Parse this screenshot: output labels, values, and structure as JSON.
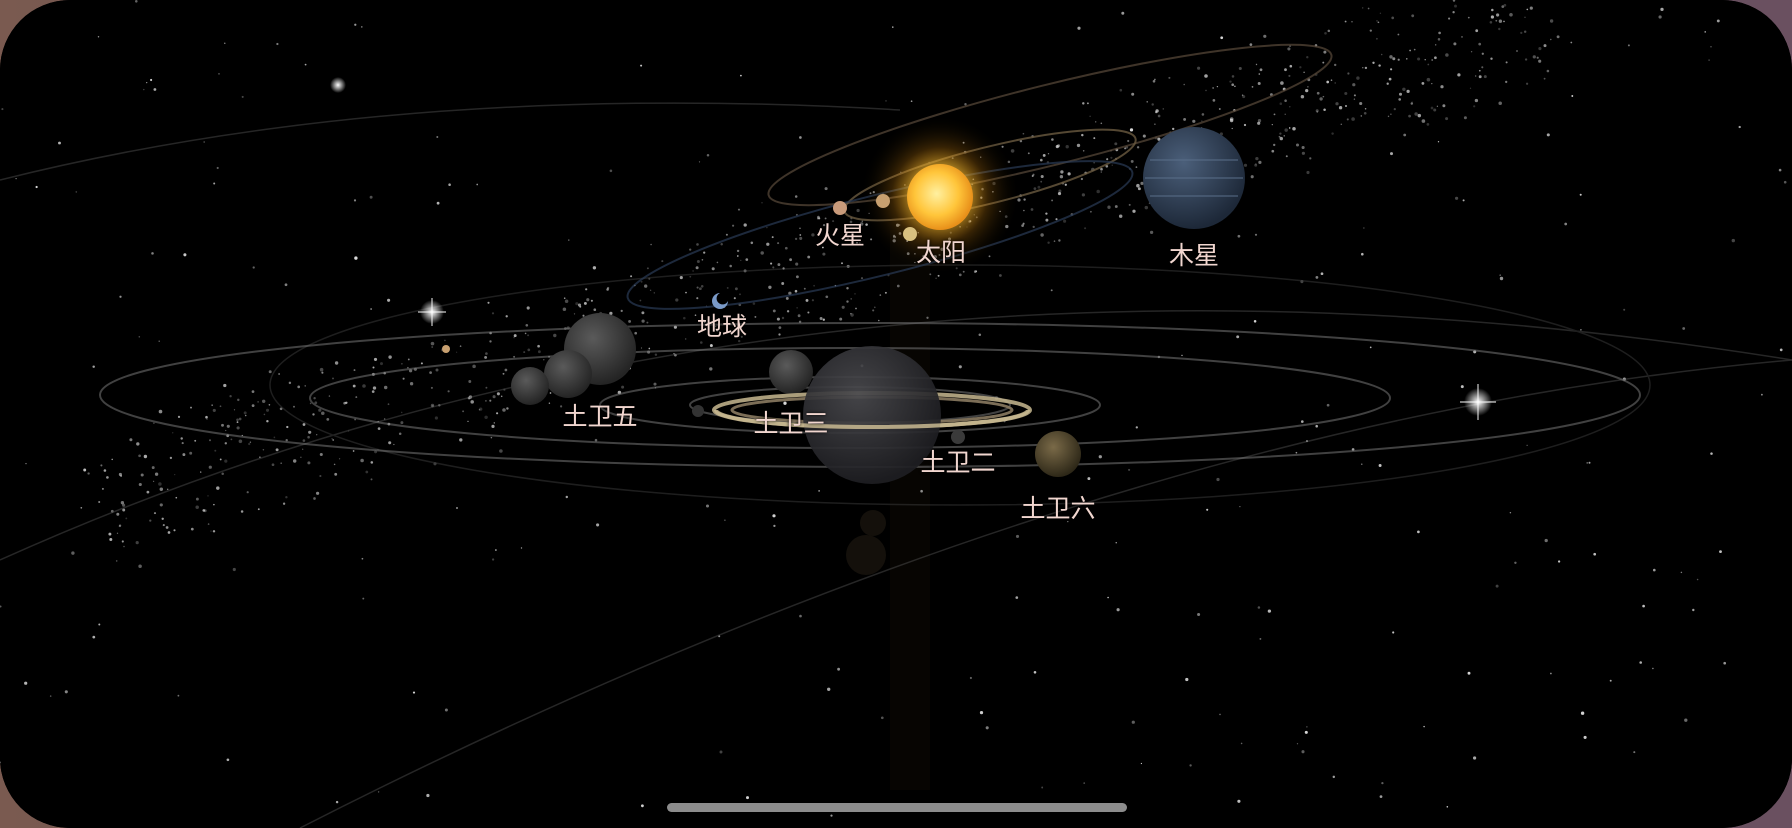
{
  "app": {
    "title": ""
  },
  "bodies": [
    {
      "id": "sun",
      "label": "太阳",
      "icon": "sun-icon",
      "color": "#f8c040"
    },
    {
      "id": "mars",
      "label": "火星",
      "icon": "planet-icon",
      "color": "#c89a7a"
    },
    {
      "id": "earth",
      "label": "地球",
      "icon": "planet-icon",
      "color": "#5a7aa8"
    },
    {
      "id": "jupiter",
      "label": "木星",
      "icon": "planet-icon",
      "color": "#3a4d66"
    },
    {
      "id": "dione",
      "label": "土卫五",
      "icon": "moon-icon",
      "color": "#4a4a4a"
    },
    {
      "id": "tethys",
      "label": "土卫三",
      "icon": "moon-icon",
      "color": "#4a4a4a"
    },
    {
      "id": "enceladus",
      "label": "土卫二",
      "icon": "moon-icon",
      "color": "#4a4a4a"
    },
    {
      "id": "titan",
      "label": "土卫六",
      "icon": "moon-icon",
      "color": "#6a5a3a"
    },
    {
      "id": "saturn",
      "label": "",
      "icon": "saturn-icon",
      "color": "#3a3a3a"
    }
  ],
  "colors": {
    "background": "#000000",
    "label": "#f1d6cf",
    "orbit": "#6a6a6a",
    "sun_glow": "#ffb020"
  }
}
